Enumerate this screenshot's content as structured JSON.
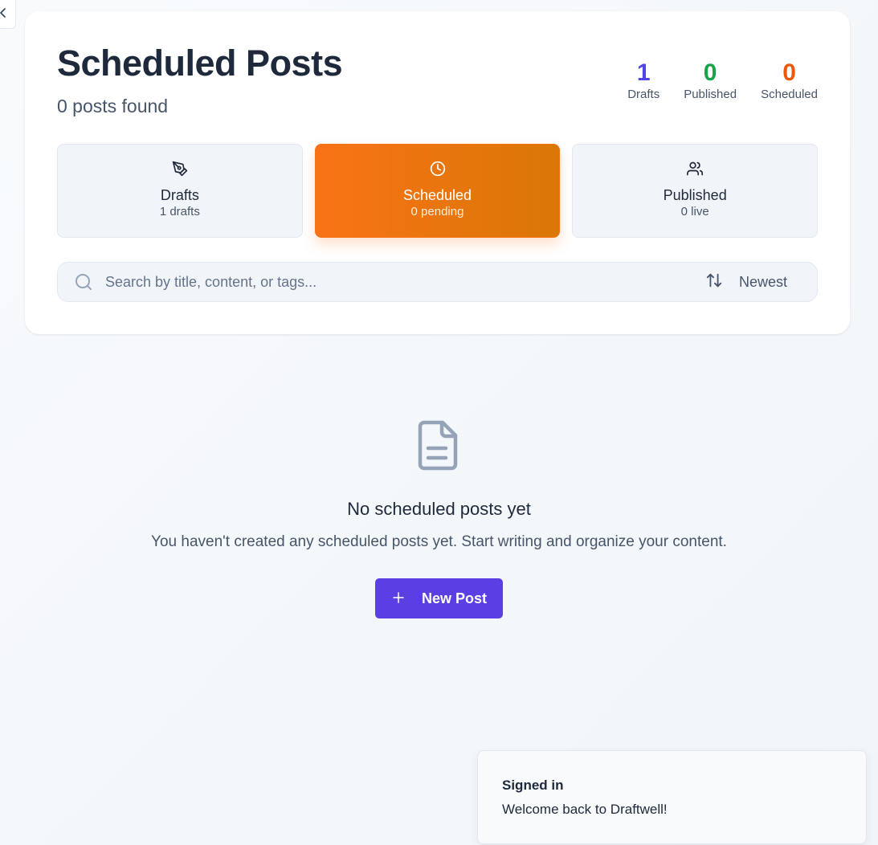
{
  "header": {
    "title": "Scheduled Posts",
    "subtitle": "0 posts found"
  },
  "stats": [
    {
      "value": "1",
      "label": "Drafts",
      "color": "#4f46e5"
    },
    {
      "value": "0",
      "label": "Published",
      "color": "#16a34a"
    },
    {
      "value": "0",
      "label": "Scheduled",
      "color": "#ea580c"
    }
  ],
  "tabs": [
    {
      "title": "Drafts",
      "sub": "1 drafts",
      "icon": "pen-icon",
      "active": false
    },
    {
      "title": "Scheduled",
      "sub": "0 pending",
      "icon": "clock-icon",
      "active": true
    },
    {
      "title": "Published",
      "sub": "0 live",
      "icon": "users-icon",
      "active": false
    }
  ],
  "search": {
    "placeholder": "Search by title, content, or tags...",
    "value": "",
    "sort_label": "Newest",
    "sort_icon": "sort-arrows-icon"
  },
  "empty_state": {
    "icon": "file-text-icon",
    "title": "No scheduled posts yet",
    "text": "You haven't created any scheduled posts yet. Start writing and organize your content.",
    "button_label": "New Post",
    "button_icon": "plus-icon"
  },
  "toast": {
    "title": "Signed in",
    "text": "Welcome back to Draftwell!"
  },
  "colors": {
    "accent": "#5b3fe4",
    "active_tab_start": "#f97316",
    "active_tab_end": "#d97706"
  }
}
